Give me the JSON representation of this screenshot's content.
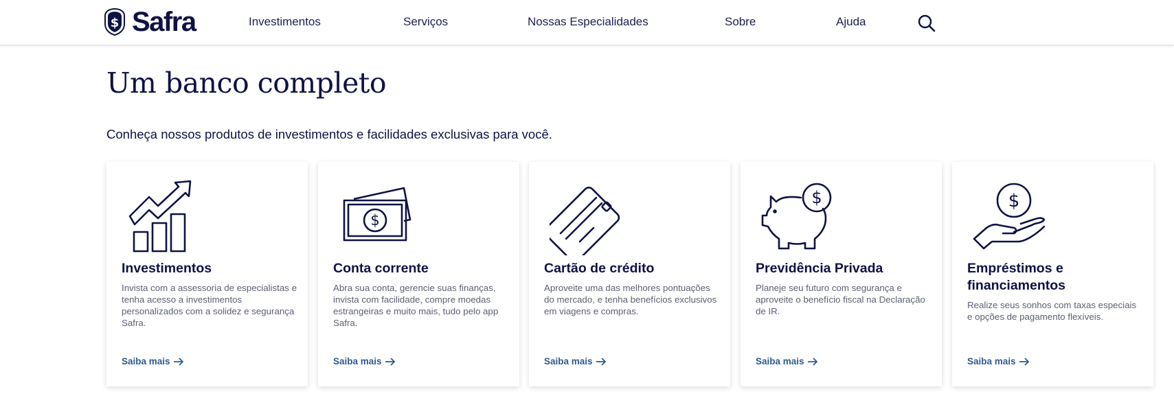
{
  "brand": {
    "name": "Safra",
    "primary_color": "#0e1244",
    "link_color": "#2f5a8f"
  },
  "nav": {
    "items": [
      {
        "label": "Investimentos"
      },
      {
        "label": "Serviços"
      },
      {
        "label": "Nossas Especialidades"
      },
      {
        "label": "Sobre"
      },
      {
        "label": "Ajuda"
      }
    ],
    "search_icon": "search-icon"
  },
  "main": {
    "title": "Um banco completo",
    "subtitle": "Conheça nossos produtos de investimentos e facilidades exclusivas para você."
  },
  "cards": [
    {
      "icon": "growth-chart-icon",
      "title": "Investimentos",
      "description": "Invista com a assessoria de especialistas e tenha acesso a investimentos personalizados com a solidez e segurança Safra.",
      "link": "Saiba mais"
    },
    {
      "icon": "money-bills-icon",
      "title": "Conta corrente",
      "description": "Abra sua conta, gerencie suas finanças, invista com facilidade, compre moedas estrangeiras e muito mais, tudo pelo app Safra.",
      "link": "Saiba mais"
    },
    {
      "icon": "credit-card-icon",
      "title": "Cartão de crédito",
      "description": "Aproveite uma das melhores pontuações do mercado, e tenha benefícios exclusivos em viagens e compras.",
      "link": "Saiba mais"
    },
    {
      "icon": "piggy-bank-icon",
      "title": "Previdência Privada",
      "description": "Planeje seu futuro com segurança e aproveite o benefício fiscal na Declaração de IR.",
      "link": "Saiba mais"
    },
    {
      "icon": "hand-coin-icon",
      "title": "Empréstimos e financiamentos",
      "description": "Realize seus sonhos com taxas especiais e opções de pagamento flexíveis.",
      "link": "Saiba mais"
    }
  ]
}
